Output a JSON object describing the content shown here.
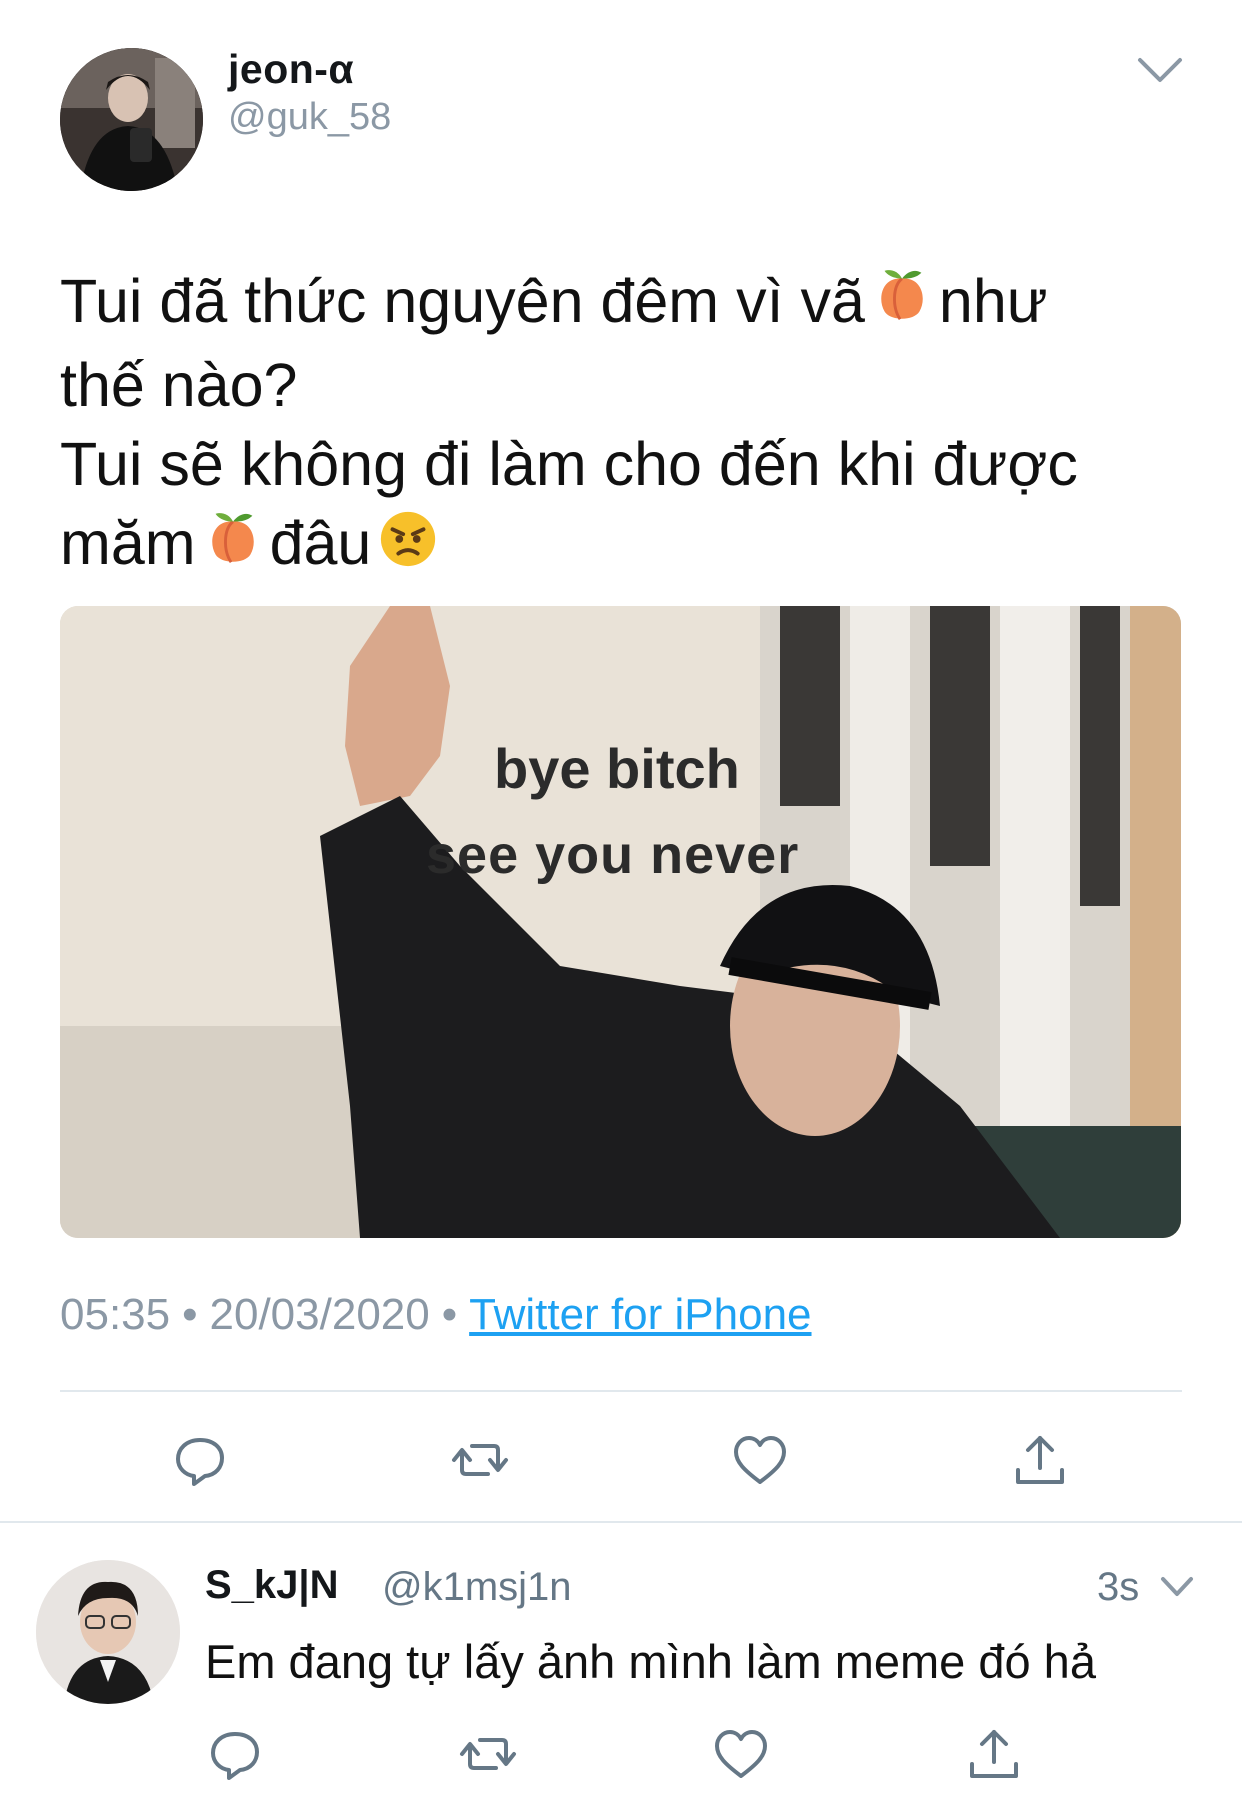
{
  "tweet": {
    "display_name": "jeon-α",
    "handle": "@guk_58",
    "text_lines": [
      [
        "Tui đã thức nguyên đêm vì vã",
        "peach-emoji",
        "như"
      ],
      [
        "thế nào?"
      ],
      [
        "Tui sẽ không đi làm cho đến khi được"
      ],
      [
        "măm",
        "peach-emoji",
        "đâu",
        "angry-face-emoji"
      ]
    ],
    "line1_a": "Tui đã thức nguyên đêm vì vã",
    "line1_b": "như",
    "line2": "thế nào?",
    "line3": "Tui sẽ không đi làm cho đến khi được",
    "line4_a": "măm",
    "line4_b": "đâu",
    "media": {
      "caption_line1": "bye bitch",
      "caption_line2": "see you never"
    },
    "time": "05:35",
    "date": "20/03/2020",
    "separator": "•",
    "source": "Twitter for iPhone",
    "actions": [
      "reply-icon",
      "retweet-icon",
      "like-icon",
      "share-icon"
    ]
  },
  "reply": {
    "display_name": "S_kJ|N",
    "handle": "@k1msj1n",
    "time": "3s",
    "text": "Em đang tự lấy ảnh mình làm meme đó hả",
    "actions": [
      "reply-icon",
      "retweet-icon",
      "like-icon",
      "share-icon"
    ]
  },
  "colors": {
    "link": "#1da1f2",
    "secondary_text": "#8b98a5",
    "icon": "#657786",
    "divider": "#e1e8ed"
  }
}
